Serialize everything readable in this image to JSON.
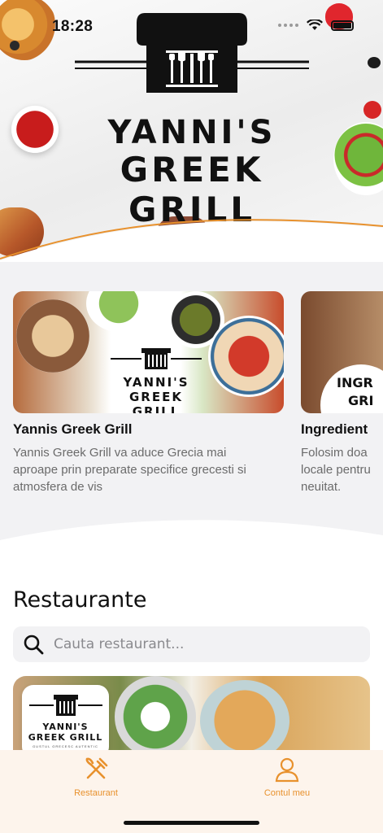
{
  "status_bar": {
    "time": "18:28"
  },
  "hero": {
    "logo_line1": "YANNI'S",
    "logo_line2": "GREEK GRILL"
  },
  "carousel": [
    {
      "title": "Yannis Greek Grill",
      "description": "Yannis Greek Grill va aduce Grecia mai aproape prin preparate specifice grecesti si atmosfera de vis",
      "image_logo_line1": "YANNI'S",
      "image_logo_line2": "GREEK GRILL"
    },
    {
      "title": "Ingredient",
      "description": "Folosim doa locale pentru neuitat.",
      "image_text_line1": "INGR",
      "image_text_line2": "GRI"
    }
  ],
  "restaurants": {
    "heading": "Restaurante",
    "search_placeholder": "Cauta restaurant...",
    "card_logo_line1": "YANNI'S",
    "card_logo_line2": "GREEK GRILL",
    "card_logo_tagline": "GUSTUL GRECESC AUTENTIC"
  },
  "tabbar": {
    "tabs": [
      {
        "label": "Restaurant",
        "icon": "fork-knife-icon"
      },
      {
        "label": "Contul meu",
        "icon": "user-icon"
      }
    ]
  },
  "colors": {
    "accent": "#e8912d",
    "tabbar_bg": "#fdf4ec",
    "section_bg": "#f2f2f4"
  }
}
